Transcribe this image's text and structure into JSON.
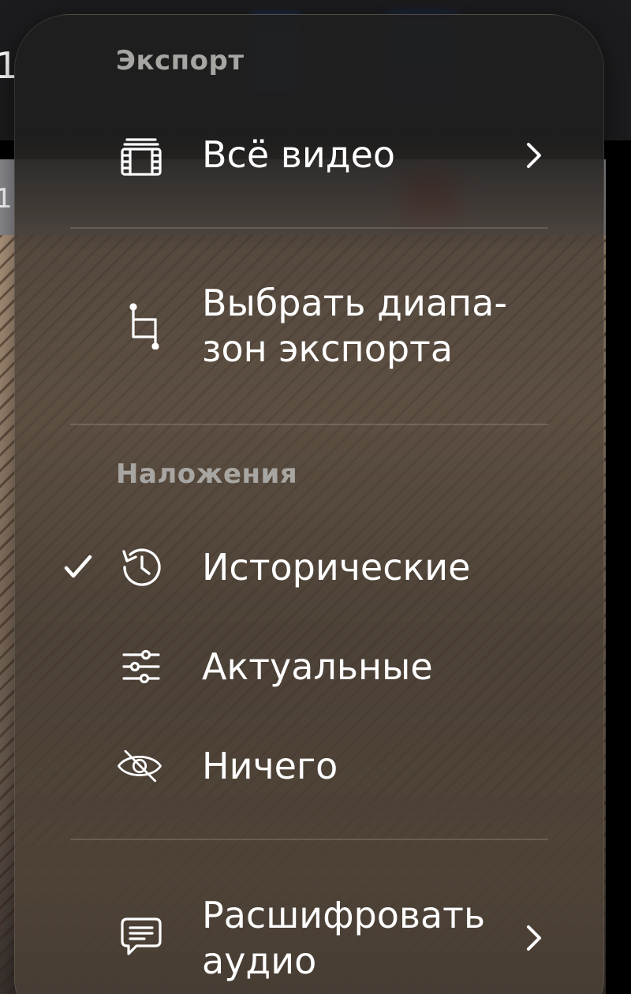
{
  "background": {
    "title_fragment": "1",
    "strip_fragment": "1"
  },
  "menu": {
    "export_section": {
      "header": "Экспорт",
      "items": [
        {
          "label": "Всё видео",
          "icon": "film-stack-icon",
          "has_submenu": true
        },
        {
          "label": "Выбрать диапа-\nзон экспорта",
          "icon": "crop-icon",
          "has_submenu": false
        }
      ]
    },
    "overlays_section": {
      "header": "Наложения",
      "items": [
        {
          "label": "Исторические",
          "icon": "history-clock-icon",
          "checked": true
        },
        {
          "label": "Актуальные",
          "icon": "sliders-icon",
          "checked": false
        },
        {
          "label": "Ничего",
          "icon": "eye-slash-icon",
          "checked": false
        }
      ]
    },
    "transcribe_item": {
      "label": "Расшифровать\nаудио",
      "icon": "speech-bubble-icon",
      "has_submenu": true
    }
  },
  "colors": {
    "text": "#ffffff",
    "header": "#a8a6a2",
    "divider": "rgba(255,255,255,0.14)"
  }
}
